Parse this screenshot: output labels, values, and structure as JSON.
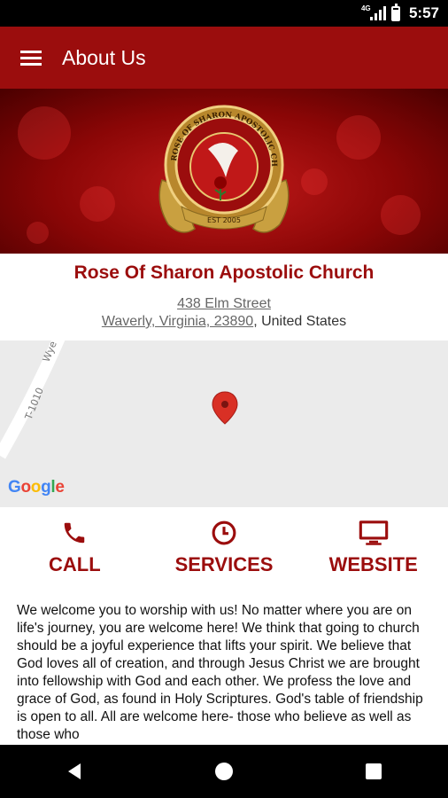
{
  "status_bar": {
    "network": "4G",
    "time": "5:57",
    "battery_level": 0.8
  },
  "app_bar": {
    "title": "About Us"
  },
  "church": {
    "name": "Rose Of Sharon Apostolic Church",
    "street": "438 Elm Street",
    "city_state_zip": "Waverly, Virginia, 23890",
    "country": ", United States",
    "logo_text": "ROSE OF SHARON APOSTOLIC CHURCH",
    "logo_est": "EST 2005"
  },
  "map": {
    "road_label_1": "Wye St",
    "road_label_2": "T-1010",
    "provider": "Google"
  },
  "actions": [
    {
      "label": "CALL",
      "icon": "phone-icon"
    },
    {
      "label": "SERVICES",
      "icon": "clock-icon"
    },
    {
      "label": "WEBSITE",
      "icon": "monitor-icon"
    }
  ],
  "description": "We welcome you to worship with us! No matter where you are on life's journey, you are welcome here! We think that going to church should be a joyful experience that lifts your spirit. We believe that God loves all of creation, and through Jesus Christ we are brought into fellowship with God and each other. We profess the love and grace of God, as found in Holy Scriptures. God's table of friendship is open to all. All are welcome here- those who believe as well as those who",
  "colors": {
    "primary": "#9b0d0d",
    "gold": "#c9a040",
    "map_pin": "#d93025"
  }
}
